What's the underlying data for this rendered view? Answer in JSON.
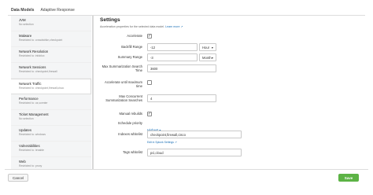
{
  "tabs": [
    {
      "label": "Data Models"
    },
    {
      "label": "Adaptive Response"
    }
  ],
  "sidebar": {
    "items": [
      {
        "title": "JVM",
        "sub": "No selection"
      },
      {
        "title": "Malware",
        "sub": "Restricted to: crowdstrike,checkpoint"
      },
      {
        "title": "Network Resolution",
        "sub": "Restricted to: infoblox"
      },
      {
        "title": "Network Sessions",
        "sub": "Restricted to: checkpoint,firewall"
      },
      {
        "title": "Network Traffic",
        "sub": "Restricted to: checkpoint,firewall,cisco"
      },
      {
        "title": "Performance",
        "sub": "Restricted to: os,vcenter"
      },
      {
        "title": "Ticket Management",
        "sub": "No selection"
      },
      {
        "title": "Updates",
        "sub": "Restricted to: windows"
      },
      {
        "title": "Vulnerabilities",
        "sub": "Restricted to: tenable"
      },
      {
        "title": "Web",
        "sub": "Restricted to: proxy"
      }
    ]
  },
  "settings": {
    "title": "Settings",
    "description": "Acceleration properties for the selected data model.",
    "learn_more": "Learn more ↗",
    "accelerate_label": "Accelerate",
    "accelerate_checked": "✓",
    "backfill_label": "Backfill Range",
    "backfill_value": "-12",
    "backfill_unit": "Hour",
    "summary_label": "Summary Range",
    "summary_value": "-3",
    "summary_unit": "Month",
    "max_time_label": "Max Summarization Search Time",
    "max_time_value": "3600",
    "accel_until_label": "Accelerate until maximum time",
    "max_concurrent_label": "Max Concurrent Summarization Searches",
    "max_concurrent_value": "4",
    "manual_rebuilds_label": "Manual rebuilds",
    "manual_rebuilds_checked": "✓",
    "priority_label": "Schedule priority",
    "priority_value": "Highest ▾",
    "indexes_label": "Indexes whitelist",
    "indexes_value": "checkpoint,firewall,cisco",
    "edit_link": "Edit in Splunk Settings ↗",
    "tags_label": "Tags whitelist",
    "tags_value": "pci,cloud"
  },
  "footer": {
    "cancel": "Cancel",
    "save": "Save"
  },
  "colors": {
    "save_green": "#5cb345",
    "link_blue": "#1a6fb5"
  }
}
